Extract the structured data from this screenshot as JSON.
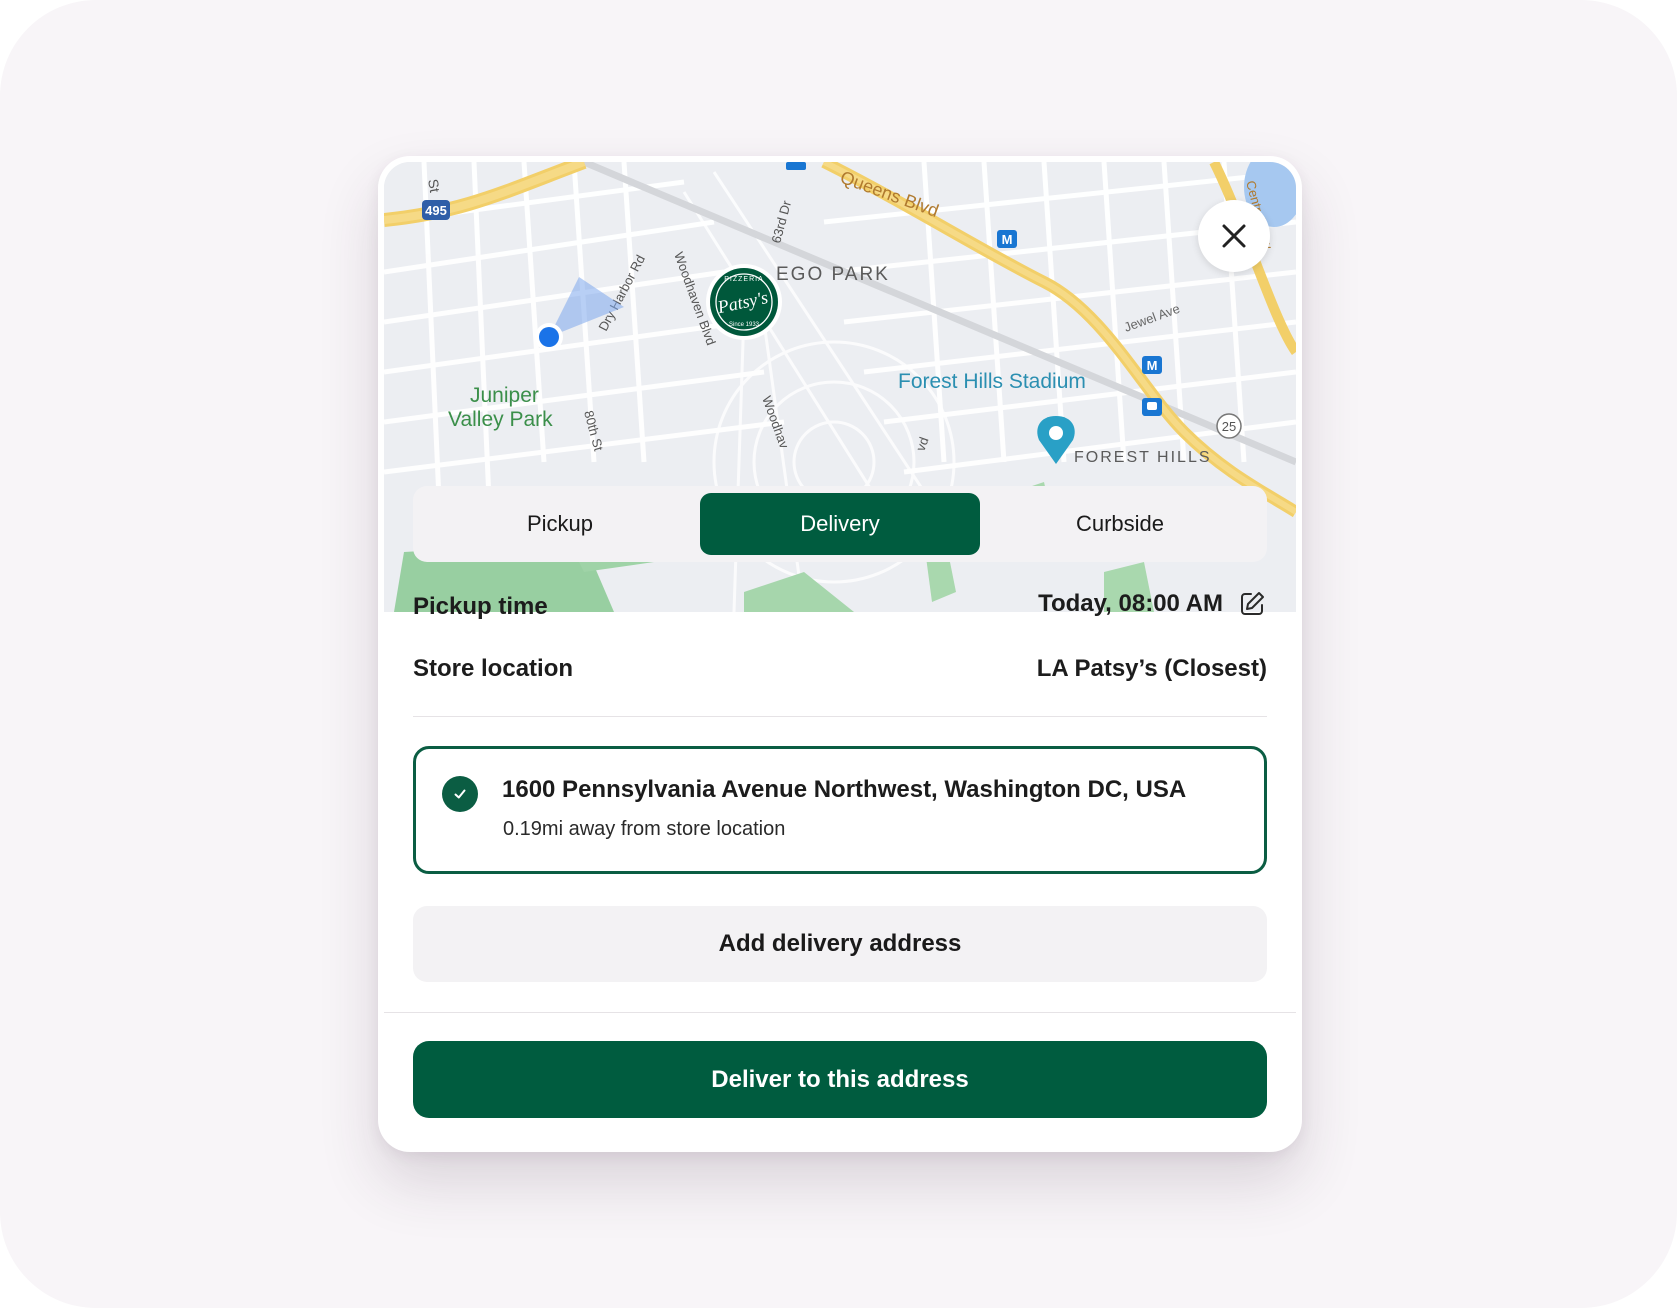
{
  "map": {
    "labels": {
      "interstate": "495",
      "queens_blvd": "Queens Blvd",
      "ego_park": "EGO PARK",
      "street_st": "St",
      "dry_harbor": "Dry Harbor Rd",
      "woodhaven": "Woodhaven Blvd",
      "woodhaven_south": "Woodhav",
      "street_63rd": "63rd Dr",
      "jewel_ave": "Jewel Ave",
      "central_pkwy": "Central Pkw",
      "park_line1": "Juniper",
      "park_line2": "Valley Park",
      "street_80th": "80th St",
      "forest_hills_stadium": "Forest Hills Stadium",
      "forest_hills": "FOREST HILLS",
      "route_25": "25",
      "metro": "M",
      "bottom_fragment": "vd"
    },
    "logo": {
      "top": "PIZZERIA",
      "script": "Patsy's",
      "bottom": "Since 1933"
    }
  },
  "tabs": [
    {
      "label": "Pickup",
      "active": false
    },
    {
      "label": "Delivery",
      "active": true
    },
    {
      "label": "Curbside",
      "active": false
    }
  ],
  "details": {
    "pickup_time_label": "Pickup time",
    "pickup_time_value": "Today, 08:00 AM",
    "store_location_label": "Store location",
    "store_location_value": "LA Patsy’s (Closest)"
  },
  "address": {
    "title": "1600 Pennsylvania Avenue Northwest, Washington DC, USA",
    "subtitle": "0.19mi away from store location",
    "selected": true
  },
  "add_address_label": "Add delivery address",
  "primary_button_label": "Deliver to this address",
  "colors": {
    "brand": "#005c3f",
    "outline": "#0b5d43",
    "surface": "#f3f2f4"
  },
  "icons": {
    "close": "close-icon",
    "edit": "edit-icon",
    "check": "check-icon",
    "location": "user-location-icon"
  }
}
